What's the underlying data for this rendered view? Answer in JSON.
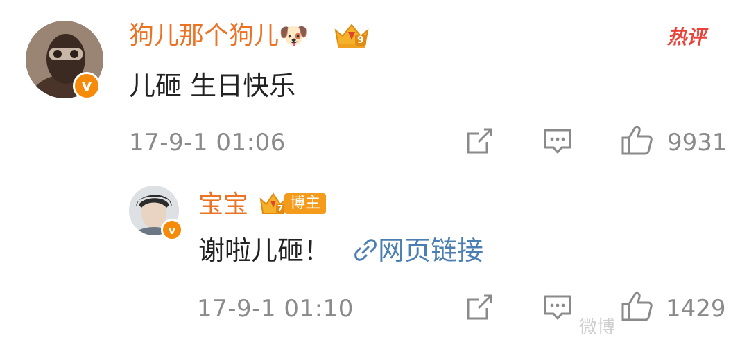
{
  "comment": {
    "username": "狗儿那个狗儿",
    "username_emoji": "🐶",
    "level_badge": "9",
    "hot_label": "热评",
    "text": "儿砸 生日快乐",
    "timestamp": "17-9-1 01:06",
    "like_count": "9931"
  },
  "reply": {
    "username": "宝宝",
    "level_badge": "7",
    "author_badge": "博主",
    "text": "谢啦儿砸！",
    "link_text": "网页链接",
    "timestamp": "17-9-1 01:10",
    "like_count": "1429"
  },
  "watermark": "微博",
  "colors": {
    "username": "#eb7326",
    "link": "#4b7eb2",
    "meta": "#8a8a8a",
    "hot": "#e8423a",
    "verified": "#f58a0b"
  }
}
